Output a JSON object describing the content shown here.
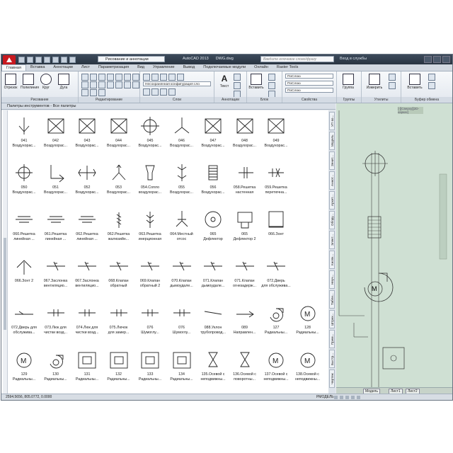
{
  "title": {
    "app": "AutoCAD 2013",
    "file": "DWG.dwg",
    "workspace": "Рисование и аннотации",
    "search_placeholder": "Введите ключевое слово/фразу",
    "login": "Вход в службы"
  },
  "tabs": [
    "Главная",
    "Вставка",
    "Аннотации",
    "Лист",
    "Параметризация",
    "Вид",
    "Управление",
    "Вывод",
    "Подключаемые модули",
    "Онлайн",
    "Raster Tools"
  ],
  "ribbon": {
    "draw": {
      "title": "Рисование",
      "buttons": [
        "Отрезок",
        "Полилиния",
        "Круг",
        "Дуга"
      ]
    },
    "modify": {
      "title": "Редактирование"
    },
    "layers": {
      "title": "Слои",
      "combo": "Несохраненная конфигурация сло"
    },
    "annotation": {
      "title": "Аннотации",
      "buttons": [
        "Текст"
      ]
    },
    "block": {
      "title": "Блок",
      "buttons": [
        "Вставить"
      ]
    },
    "properties": {
      "title": "Свойства",
      "combo1": "ПоСлою",
      "combo2": "ПоСлою",
      "combo3": "ПоСлою"
    },
    "groups": {
      "title": "Группы",
      "buttons": [
        "Группа"
      ]
    },
    "utilities": {
      "title": "Утилиты",
      "buttons": [
        "Измерить"
      ]
    },
    "clipboard": {
      "title": "Буфер обмена",
      "buttons": [
        "Вставить"
      ]
    }
  },
  "palette": {
    "title": "Палитры инструментов - Все палитры",
    "side_tabs": [
      "УП во...",
      "Модель",
      "Зенит...",
      "Аннот...",
      "Архит...",
      "Обору...",
      "Элект...",
      "Кнопк...",
      "Неуч...",
      "Табли...",
      "Штрих...",
      "Прим...",
      "Быстр...",
      "Чертеж"
    ],
    "rows": [
      [
        "041\nВоздухорас...",
        "042\nВоздухорас...",
        "043\nВоздухорас...",
        "044\nВоздухорас...",
        "045\nВоздухорас...",
        "046\nВоздухорас...",
        "047\nВоздухорас...",
        "048\nВоздухорас...",
        "049\nВоздухорас..."
      ],
      [
        "050\nВоздухорас...",
        "051\nВоздухорас...",
        "052\nВоздухорас...",
        "053\nВоздухорас...",
        "054.Сопло\nвоздухорас...",
        "055\nВоздухорас...",
        "056\nВоздухорас...",
        "058.Решетка\nнастенная",
        "059.Решетка\nперетючна..."
      ],
      [
        "060.Решетка\nлинейная ...",
        "061.Решетка\nлинейная ...",
        "062.Решетка\nлинейная ...",
        "062.Решетка\nжалюзийн...",
        "063.Решетка\nинерционная",
        "064.Местный\nотсос",
        "065\nДефлектор",
        "065\nДефлектор 2",
        "066.Зонт"
      ],
      [
        "066.Зонт 2",
        "067.Заслонка\nвентиляцио...",
        "067.Заслонка\nвентиляцио...",
        "068.Клапан\nобратный",
        "069.Клапан\nобратный 2",
        "070.Клапан\nдымоудале...",
        "071.Клапан\nдымоудале...",
        "071.Клапан\nогнезадерж...",
        "072.Дверь\nдля обслужива..."
      ],
      [
        "072.Дверь для\nобслужива...",
        "073.Люк для\nчистки возд...",
        "074.Люк для\nчистки возд...",
        "075.Лючок\nдля замер...",
        "076\nШумоглу...",
        "076\nШумоглу...",
        "088.Уклон\nтрубопровод...",
        "089\nНаправлен...",
        "127\nРадиальны...",
        "128\nРадиальны..."
      ],
      [
        "129\nРадиальны...",
        "130\nРадиальны...",
        "131\nРадиальны...",
        "132\nРадиальны...",
        "133\nРадиальны...",
        "134\nРадиальны...",
        "135.Осевой с\nнеподвижны...",
        "136.Осевой с\nповоротны...",
        "137.Осевой с\nнеподвижны...",
        "138.Осевой с\nнеподвижны..."
      ]
    ]
  },
  "drawing": {
    "view_label": "[-][Сверху][2D-каркас]",
    "tabs": [
      "Модель",
      "Лист1",
      "Лист2"
    ]
  },
  "status": {
    "coords": "2594.5656, 805.0772, 0.0000",
    "mode": "РМОДЕЛЬ"
  }
}
